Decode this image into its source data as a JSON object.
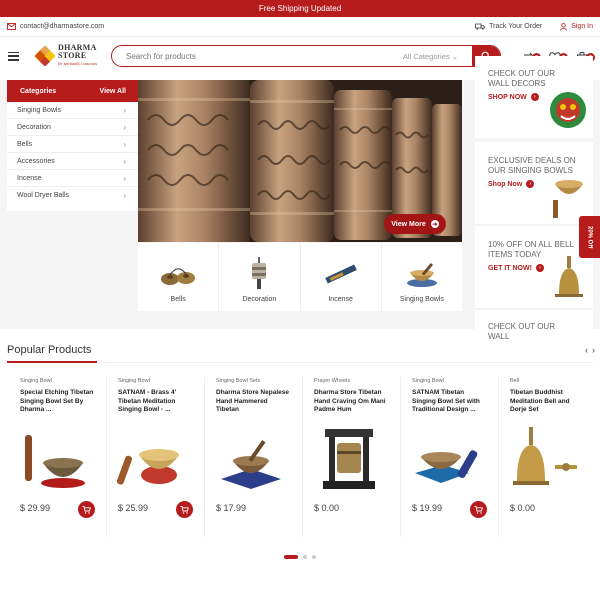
{
  "topbar": {
    "text": "Free Shipping Updated"
  },
  "infobar": {
    "email": "contact@dharmastore.com",
    "track": "Track Your Order",
    "signin": "Sign In"
  },
  "logo": {
    "name_line1": "DHARMA",
    "name_line2": "STORE",
    "tagline": "for spiritually conscious"
  },
  "search": {
    "placeholder": "Search for products",
    "category": "All Categories"
  },
  "header_badges": {
    "compare": "0",
    "wishlist": "0",
    "cart": "0"
  },
  "categories": {
    "title": "Categories",
    "view_all": "View All",
    "items": [
      {
        "label": "Singing Bowls"
      },
      {
        "label": "Decoration"
      },
      {
        "label": "Bells"
      },
      {
        "label": "Accessories"
      },
      {
        "label": "Incense"
      },
      {
        "label": "Wool Dryer Balls"
      }
    ]
  },
  "hero": {
    "button": "View More"
  },
  "tiles": [
    {
      "label": "Bells"
    },
    {
      "label": "Decoration"
    },
    {
      "label": "Incense"
    },
    {
      "label": "Singing Bowls"
    }
  ],
  "promos": [
    {
      "title": "CHECK OUT OUR WALL DECORS",
      "cta": "SHOP NOW"
    },
    {
      "title": "EXCLUSIVE DEALS ON OUR SINGING BOWLS",
      "cta": "Shop Now"
    },
    {
      "title": "10% OFF ON ALL BELL ITEMS TODAY",
      "cta": "GET IT NOW!"
    },
    {
      "title": "CHECK OUT OUR WALL",
      "cta": ""
    }
  ],
  "off_tab": "20% Off",
  "popular": {
    "title": "Popular Products",
    "products": [
      {
        "category": "Singing Bowl",
        "name": "Special Etching Tibetan Singing Bowl Set By Dharma ...",
        "price": "$ 29.99",
        "cart": true
      },
      {
        "category": "Singing Bowl",
        "name": "SATNAM - Brass 4' Tibetan Meditation Singing Bowl - ...",
        "price": "$ 25.99",
        "cart": true
      },
      {
        "category": "Singing Bowl Sets",
        "name": "Dharma Store Nepalese Hand Hammered Tibetan",
        "price": "$ 17.99",
        "cart": false
      },
      {
        "category": "Prayer Wheels",
        "name": "Dharma Store Tibetan Hand Craving Om Mani Padme Hum",
        "price": "$ 0.00",
        "cart": false
      },
      {
        "category": "Singing Bowl",
        "name": "SATNAM Tibetan Singing Bowl Set with Traditional Design ...",
        "price": "$ 19.99",
        "cart": true
      },
      {
        "category": "Bell",
        "name": "Tibetan Buddhist Meditation Bell and Dorje Set",
        "price": "$ 0.00",
        "cart": false
      }
    ]
  },
  "colors": {
    "accent": "#b71c1c"
  }
}
